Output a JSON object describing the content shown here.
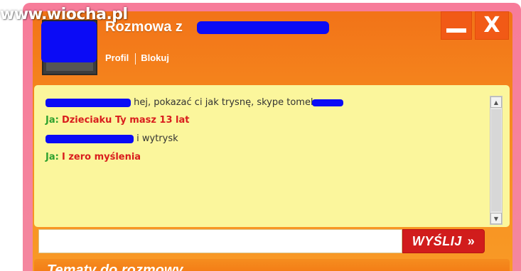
{
  "watermark": "www.wiocha.pl",
  "header": {
    "title_prefix": "Rozmowa z",
    "links": {
      "profile": "Profil",
      "block": "Blokuj"
    },
    "minimize_glyph": "",
    "close_glyph": "X"
  },
  "chat": {
    "messages": [
      {
        "sender": "",
        "text": "hej, pokazać ci jak trysnę, skype tomek",
        "style": "plain"
      },
      {
        "sender": "Ja:",
        "text": "Dzieciaku Ty masz 13 lat",
        "style": "mine"
      },
      {
        "sender": "",
        "text": "i wytrysk",
        "style": "plain"
      },
      {
        "sender": "Ja:",
        "text": "I zero myślenia",
        "style": "mine"
      }
    ],
    "scroll_up": "▲",
    "scroll_down": "▼"
  },
  "composer": {
    "input_value": "",
    "send_label": "WYŚLIJ",
    "send_arrows": "»"
  },
  "bottom_bar": {
    "label": "Tematy do rozmowy"
  },
  "colors": {
    "frame": "#f77c9a",
    "window": "#f58a1e",
    "chat_bg": "#fbf69c",
    "my_name": "#2ea12e",
    "my_text": "#d91d1d",
    "send_button": "#d11c1c",
    "redaction": "#0b0bf6"
  },
  "icons": [
    "minimize-icon",
    "close-icon",
    "scroll-up-icon",
    "scroll-down-icon",
    "send-arrows-icon"
  ]
}
